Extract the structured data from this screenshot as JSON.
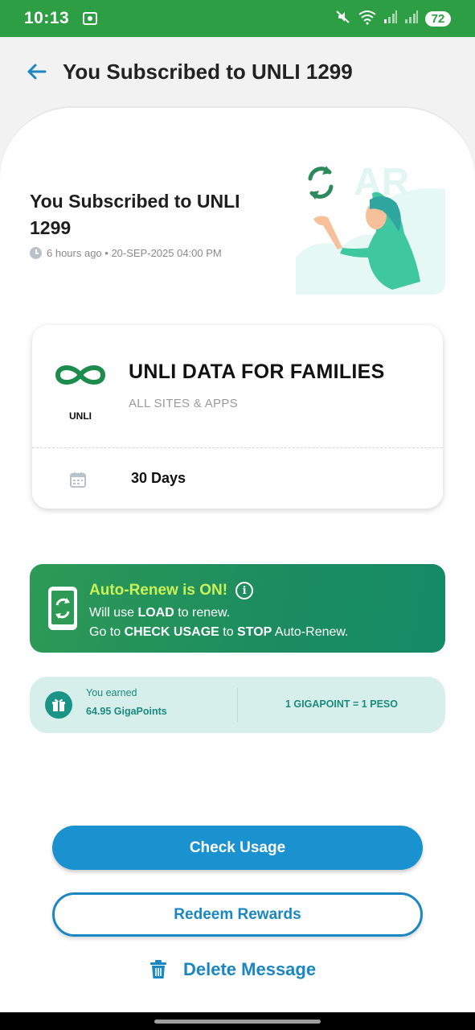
{
  "status_bar": {
    "time": "10:13",
    "battery": "72",
    "icons": [
      "screen-record-icon",
      "mute-icon",
      "wifi-icon",
      "signal-icon",
      "signal-icon"
    ]
  },
  "header": {
    "back_icon": "arrow-left-icon",
    "title": "You Subscribed to UNLI 1299"
  },
  "hero": {
    "title": "You Subscribed to UNLI 1299",
    "meta": "6 hours ago • 20-SEP-2025 04:00 PM",
    "illustration_text": "AR"
  },
  "plan_card": {
    "logo_label": "UNLI",
    "name": "UNLI DATA FOR FAMILIES",
    "description": "ALL SITES & APPS",
    "validity": "30 Days"
  },
  "auto_renew": {
    "title": "Auto-Renew is ON!",
    "line1": {
      "a": "Will use ",
      "b": "LOAD",
      "c": " to renew."
    },
    "line2": {
      "a": "Go to ",
      "b": "CHECK USAGE",
      "c": " to ",
      "d": "STOP",
      "e": " Auto-Renew."
    }
  },
  "points": {
    "earned_label": "You earned",
    "earned_value": "64.95 GigaPoints",
    "rate": "1 GIGAPOINT = 1 PESO"
  },
  "actions": {
    "check_usage": "Check Usage",
    "redeem_rewards": "Redeem Rewards",
    "delete_message": "Delete Message"
  },
  "colors": {
    "status_green": "#2e9e44",
    "primary_blue": "#1a92d0",
    "accent_lime": "#c9f25a",
    "teal": "#1b8a7e"
  }
}
